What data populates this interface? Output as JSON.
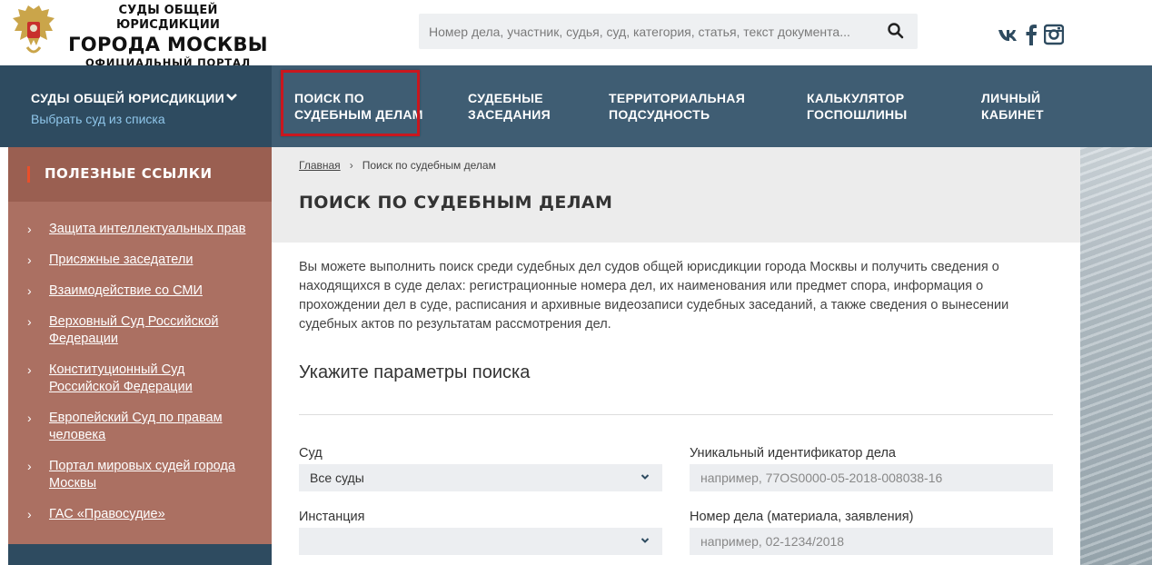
{
  "header": {
    "logo_line1": "СУДЫ ОБЩЕЙ ЮРИСДИКЦИИ",
    "logo_line2": "ГОРОДА МОСКВЫ",
    "logo_line3": "ОФИЦИАЛЬНЫЙ ПОРТАЛ",
    "search_placeholder": "Номер дела, участник, судья, суд, категория, статья, текст документа...",
    "social": [
      "vk-icon",
      "facebook-icon",
      "instagram-icon"
    ]
  },
  "nav": {
    "courts_title": "СУДЫ ОБЩЕЙ ЮРИСДИКЦИИ",
    "courts_subtitle": "Выбрать суд из списка",
    "items": [
      {
        "line1": "ПОИСК ПО",
        "line2": "СУДЕБНЫМ ДЕЛАМ"
      },
      {
        "line1": "СУДЕБНЫЕ",
        "line2": "ЗАСЕДАНИЯ"
      },
      {
        "line1": "ТЕРРИТОРИАЛЬНАЯ",
        "line2": "ПОДСУДНОСТЬ"
      },
      {
        "line1": "КАЛЬКУЛЯТОР",
        "line2": "ГОСПОШЛИНЫ"
      },
      {
        "line1": "ЛИЧНЫЙ",
        "line2": "КАБИНЕТ"
      }
    ],
    "highlight_color": "#c9171e"
  },
  "sidebar": {
    "title": "ПОЛЕЗНЫЕ ССЫЛКИ",
    "links": [
      "Защита интеллектуальных прав",
      "Присяжные заседатели",
      "Взаимодействие со СМИ",
      "Верховный Суд Российской Федерации",
      "Конституционный Суд Российской Федерации",
      "Европейский Суд по правам человека",
      "Портал мировых судей города Москвы",
      "ГАС «Правосудие»"
    ]
  },
  "main": {
    "breadcrumb_home": "Главная",
    "breadcrumb_current": "Поиск по судебным делам",
    "title": "ПОИСК ПО СУДЕБНЫМ ДЕЛАМ",
    "intro": "Вы можете выполнить поиск среди судебных дел судов общей юрисдикции города Москвы и получить сведения о находящихся в суде делах: регистрационные номера дел, их наименования или предмет спора, информация о прохождении дел в суде, расписания и архивные видеозаписи судебных заседаний, а также сведения о вынесении судебных актов по результатам рассмотрения дел.",
    "params_title": "Укажите параметры поиска",
    "fields": {
      "court_label": "Суд",
      "court_value": "Все суды",
      "uid_label": "Уникальный идентификатор дела",
      "uid_placeholder": "например, 77OS0000-05-2018-008038-16",
      "instance_label": "Инстанция",
      "instance_value": "",
      "case_label": "Номер дела (материала, заявления)",
      "case_placeholder": "например, 02-1234/2018"
    }
  },
  "colors": {
    "nav_bg": "#3f5d73",
    "nav_dark": "#2e4b60",
    "sidebar_bg": "#ab7062",
    "accent_link": "#8fc6ea"
  }
}
